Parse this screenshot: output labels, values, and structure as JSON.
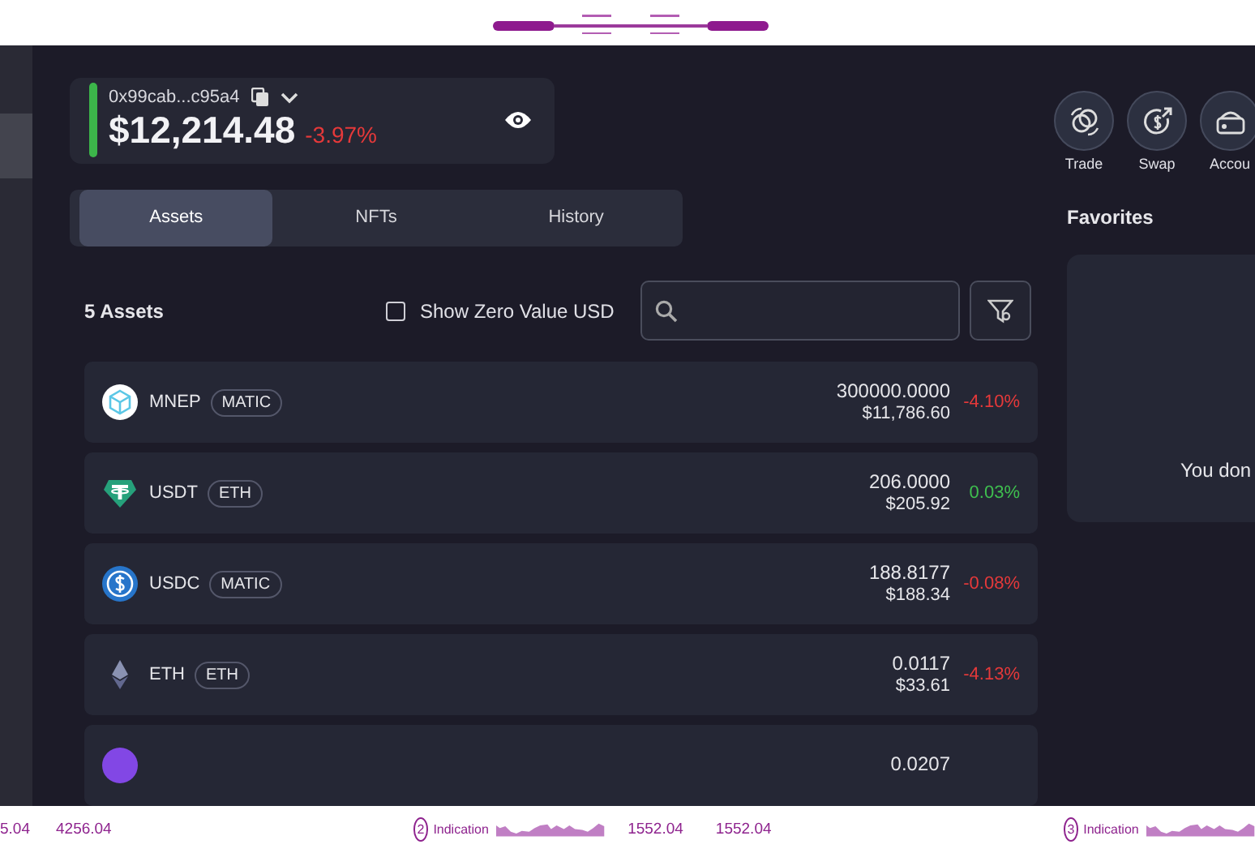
{
  "wallet": {
    "address": "0x99cab...c95a4",
    "balance": "$12,214.48",
    "change": "-3.97%",
    "color": "#e5393a"
  },
  "actions": [
    {
      "label": "Trade"
    },
    {
      "label": "Swap"
    },
    {
      "label": "Accou"
    }
  ],
  "tabs": [
    {
      "label": "Assets",
      "selected": true
    },
    {
      "label": "NFTs",
      "selected": false
    },
    {
      "label": "History",
      "selected": false
    }
  ],
  "assets_header": {
    "count": "5 Assets",
    "zero_toggle": {
      "label": "Show Zero Value USD",
      "checked": false
    }
  },
  "assets": [
    {
      "name": "MNEP",
      "network": "MATIC",
      "amount": "300000.0000",
      "value": "$11,786.60",
      "change": "-4.10%",
      "color": "#e5393a"
    },
    {
      "name": "USDT",
      "network": "ETH",
      "amount": "206.0000",
      "value": "$205.92",
      "change": "0.03%",
      "color": "#3fbf4f"
    },
    {
      "name": "USDC",
      "network": "MATIC",
      "amount": "188.8177",
      "value": "$188.34",
      "change": "-0.08%",
      "color": "#e5393a"
    },
    {
      "name": "ETH",
      "network": "ETH",
      "amount": "0.0117",
      "value": "$33.61",
      "change": "-4.13%",
      "color": "#e5393a"
    },
    {
      "amount": "0.0207"
    }
  ],
  "favorites": {
    "title": "Favorites",
    "message": "You don"
  },
  "ticker": [
    {
      "kind": "text",
      "text": "5.04"
    },
    {
      "kind": "text",
      "text": "4256.04"
    },
    {
      "kind": "indication",
      "number": "2",
      "label": "Indication"
    },
    {
      "kind": "text",
      "text": "1552.04"
    },
    {
      "kind": "text",
      "text": "1552.04"
    },
    {
      "kind": "indication",
      "number": "3",
      "label": "Indication"
    }
  ]
}
